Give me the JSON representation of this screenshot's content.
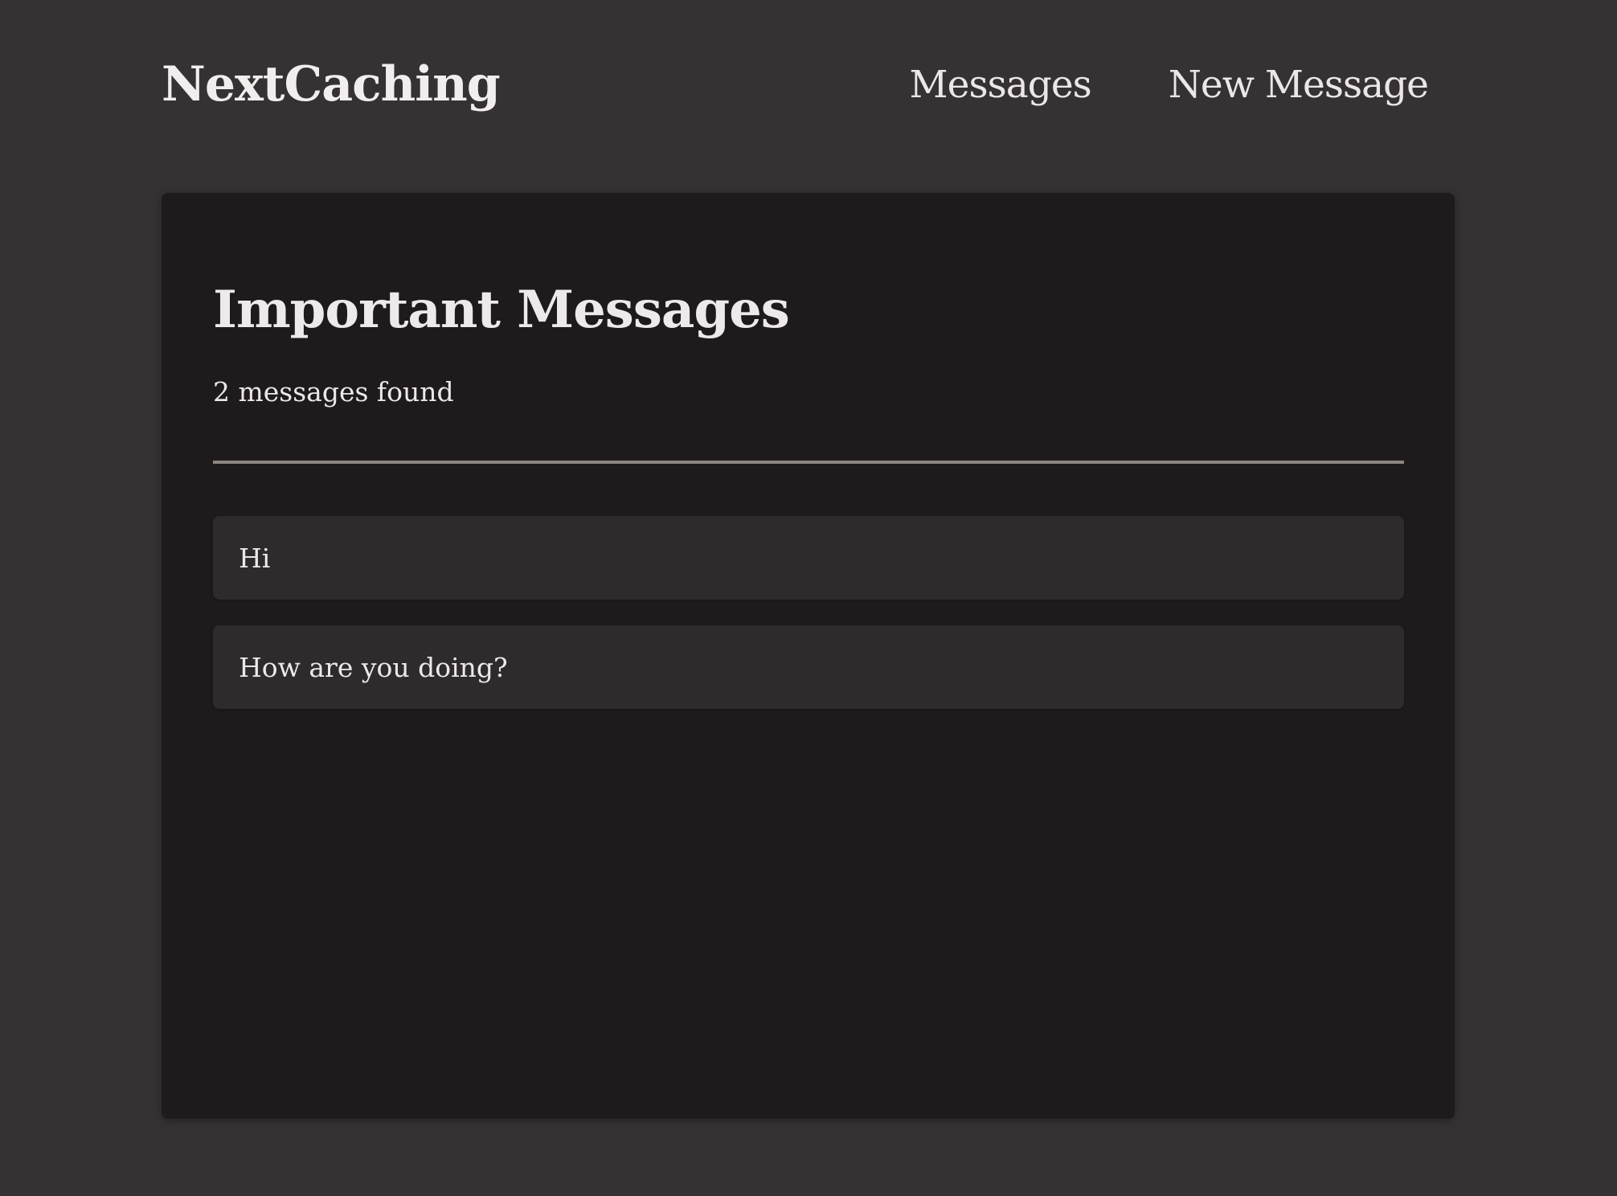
{
  "header": {
    "logo": "NextCaching",
    "nav": {
      "messages": "Messages",
      "new_message": "New Message"
    }
  },
  "main": {
    "title": "Important Messages",
    "count_text": "2 messages found",
    "messages": [
      {
        "text": "Hi"
      },
      {
        "text": "How are you doing?"
      }
    ]
  },
  "colors": {
    "page_background": "#363234",
    "card_background": "#1f1b1d",
    "message_background": "#2f2b2d",
    "divider": "#8d877f",
    "text": "#f0ebeb"
  }
}
